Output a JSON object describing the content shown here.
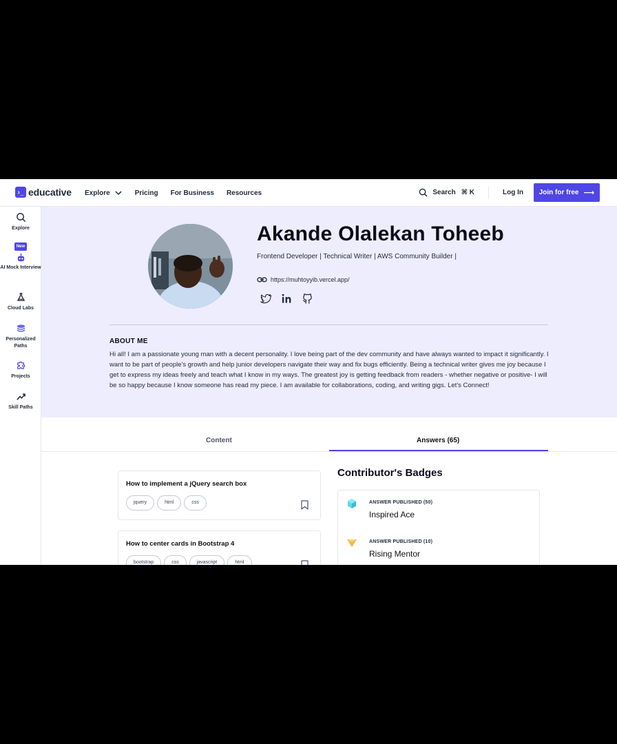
{
  "nav": {
    "logo_text": "educative",
    "explore": "Explore",
    "pricing": "Pricing",
    "for_business": "For Business",
    "resources": "Resources",
    "search": "Search",
    "search_shortcut": "⌘ K",
    "login": "Log In",
    "join": "Join for free",
    "accent": "#4f46e5"
  },
  "sidebar": {
    "items": [
      {
        "label": "Explore",
        "icon": "search-icon"
      },
      {
        "badge": "New",
        "label": "AI Mock Interview",
        "icon": "robot-icon"
      },
      {
        "label": "Cloud Labs",
        "icon": "flask-icon"
      },
      {
        "label": "Personalized Paths",
        "icon": "stack-icon"
      },
      {
        "label": "Projects",
        "icon": "puzzle-icon"
      },
      {
        "label": "Skill Paths",
        "icon": "trend-up-icon"
      }
    ]
  },
  "profile": {
    "name": "Akande Olalekan Toheeb",
    "headline": "Frontend Developer | Technical Writer | AWS Community Builder |",
    "website": "https://muhtoyyib.vercel.app/",
    "socials": [
      "twitter-icon",
      "linkedin-icon",
      "github-icon"
    ],
    "about_heading": "ABOUT ME",
    "about_text": "Hi all! I am a passionate young man with a decent personality. I love being part of the dev community and have always wanted to impact it significantly. I want to be part of people's growth and help junior developers navigate their way and fix bugs efficiently. Being a technical writer gives me joy because I get to express my ideas freely and teach what I know in my ways. The greatest joy is getting feedback from readers - whether negative or positive- I will be so happy because I know someone has read my piece. I am available for collaborations, coding, and writing gigs. Let's Connect!",
    "hero_bg": "#eeedfd"
  },
  "tabs": {
    "content": "Content",
    "answers": "Answers (65)"
  },
  "answers": [
    {
      "title": "How to implement a jQuery search box",
      "tags": [
        "jquery",
        "html",
        "css"
      ]
    },
    {
      "title": "How to center cards in Bootstrap 4",
      "tags": [
        "bootstrap",
        "css",
        "javascript",
        "html"
      ]
    }
  ],
  "badges": {
    "title": "Contributor's Badges",
    "items": [
      {
        "kind": "ANSWER PUBLISHED (50)",
        "name": "Inspired Ace",
        "icon": "cube-badge-icon",
        "color": "#5ad8e6"
      },
      {
        "kind": "ANSWER PUBLISHED (10)",
        "name": "Rising Mentor",
        "icon": "triangle-badge-icon",
        "color": "#f5b73b"
      }
    ]
  }
}
